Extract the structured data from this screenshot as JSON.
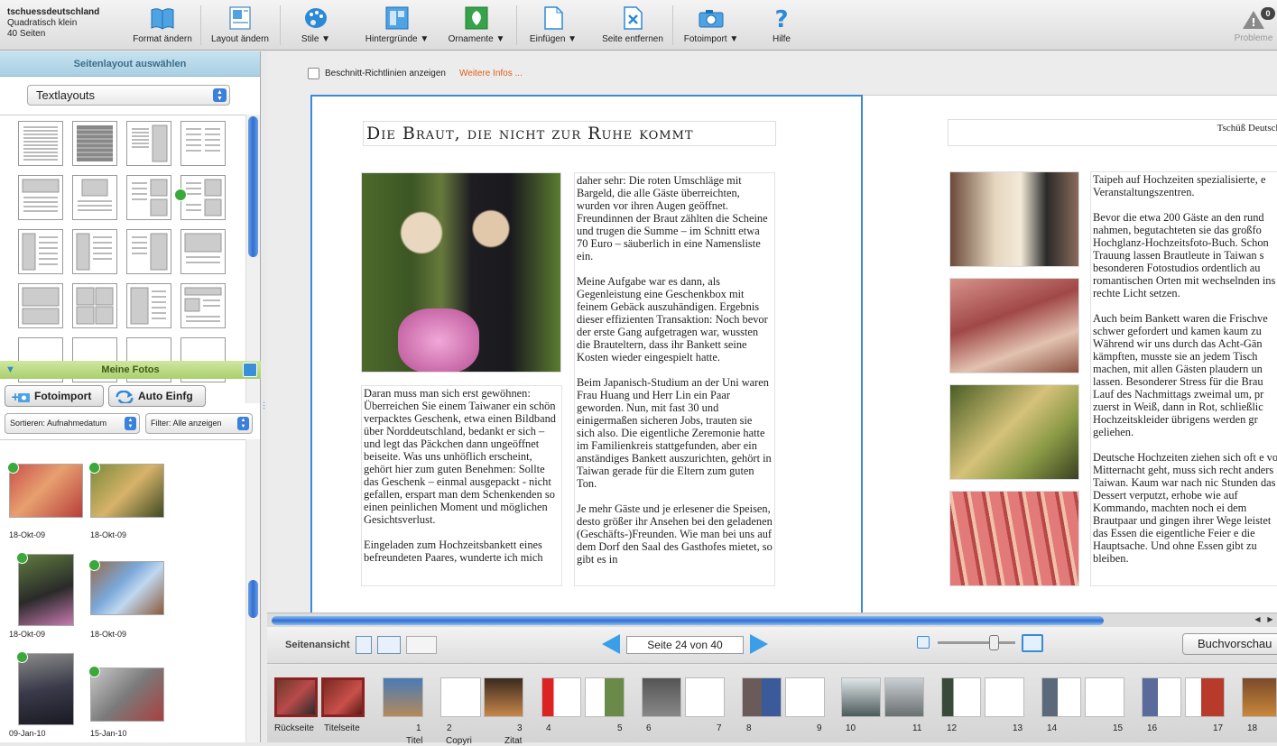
{
  "project": {
    "name": "tschuessdeutschland",
    "format": "Quadratisch klein",
    "pages": "40 Seiten"
  },
  "toolbar": {
    "items": [
      {
        "label": "Format ändern",
        "icon": "book-icon"
      },
      {
        "label": "Layout ändern",
        "icon": "layout-icon"
      },
      {
        "label": "Stile ▼",
        "icon": "palette-icon"
      },
      {
        "label": "Hintergründe ▼",
        "icon": "background-icon"
      },
      {
        "label": "Ornamente ▼",
        "icon": "ornament-icon"
      },
      {
        "label": "Einfügen ▼",
        "icon": "insert-page-icon"
      },
      {
        "label": "Seite entfernen",
        "icon": "remove-page-icon"
      },
      {
        "label": "Fotoimport ▼",
        "icon": "camera-icon"
      },
      {
        "label": "Hilfe",
        "icon": "help-icon"
      }
    ],
    "problems_label": "Probleme",
    "problems_count": "0"
  },
  "layout_panel": {
    "header": "Seitenlayout auswählen",
    "select_value": "Textlayouts"
  },
  "photos_panel": {
    "header": "Meine Fotos",
    "import_btn": "Fotoimport",
    "auto_btn": "Auto Einfg",
    "sort": "Sortieren:  Aufnahmedatum",
    "filter": "Filter: Alle anzeigen",
    "photos": [
      {
        "date": "18-Okt-09"
      },
      {
        "date": "18-Okt-09"
      },
      {
        "date": "18-Okt-09"
      },
      {
        "date": "18-Okt-09"
      },
      {
        "date": "09-Jan-10"
      },
      {
        "date": "15-Jan-10"
      }
    ]
  },
  "editor": {
    "guides_label": "Beschnitt-Richtlinien anzeigen",
    "more_info": "Weitere Infos ...",
    "title": "Die Braut, die nicht zur Ruhe kommt",
    "col1": "Daran muss man sich erst gewöhnen: Überreichen Sie einem Taiwaner ein schön verpacktes Geschenk, etwa einen Bildband über Norddeutschland, bedankt er sich – und legt das Päckchen dann ungeöffnet beiseite. Was uns unhöflich erscheint, gehört hier zum guten Benehmen: Sollte das Geschenk – einmal ausgepackt - nicht gefallen, erspart man dem Schenkenden so einen peinlichen Moment und möglichen Gesichtsverlust.\n\nEingeladen zum Hochzeitsbankett eines befreundeten Paares, wunderte ich mich",
    "col2": "daher sehr: Die roten Umschläge mit Bargeld, die alle Gäste überreichten, wurden vor ihren Augen geöffnet. Freundinnen der Braut zählten die Scheine und trugen die Summe – im Schnitt etwa 70 Euro – säuberlich in eine Namensliste ein.\n\nMeine Aufgabe war es dann, als Gegenleistung eine Geschenkbox mit feinem Gebäck auszuhändigen. Ergebnis dieser effizienten Transaktion: Noch bevor der erste Gang aufgetragen war, wussten die Brauteltern, dass ihr Bankett seine Kosten wieder eingespielt hatte.\n\nBeim Japanisch-Studium an der Uni waren Frau Huang und Herr Lin ein Paar geworden. Nun, mit fast 30 und einigermaßen sicheren Jobs, trauten sie sich also. Die eigentliche Zeremonie hatte im Familienkreis stattgefunden, aber ein anständiges Bankett auszurichten, gehört in Taiwan gerade für die Eltern zum guten Ton.\n\nJe mehr Gäste und je erlesener die Speisen, desto größer ihr Ansehen bei den geladenen (Geschäfts-)Freunden. Wie man bei uns auf dem Dorf den Saal des Gasthofes mietet, so gibt es in",
    "right_header": "Tschüß Deutschla",
    "col3": "Taipeh auf Hochzeiten spezialisierte, e Veranstaltungszentren.\n\nBevor die etwa 200 Gäste an den rund nahmen, begutachteten sie das großfo Hochglanz-Hochzeitsfoto-Buch. Schon Trauung lassen Brautleute in Taiwan s besonderen Fotostudios ordentlich au romantischen Orten mit wechselnden ins rechte Licht setzen.\n\nAuch beim Bankett waren die Frischve schwer gefordert und kamen kaum zu Während wir uns durch das Acht-Gän kämpften, musste sie an jedem Tisch machen, mit allen Gästen plaudern un lassen. Besonderer Stress für die Brau Lauf des Nachmittags zweimal um, pr zuerst in Weiß, dann in Rot, schließlic Hochzeitskleider übrigens werden gr geliehen.\n\nDeutsche Hochzeiten ziehen sich oft e vor Mitternacht geht, muss sich recht anders in Taiwan. Kaum war nach nic Stunden das Dessert verputzt, erhobe wie auf Kommando, machten noch ei dem Brautpaar und gingen ihrer Wege leistet das Essen die eigentliche Feier e die Hauptsache. Und ohne Essen gibt zu bleiben."
  },
  "nav": {
    "view_label": "Seitenansicht",
    "page_indicator": "Seite 24 von 40",
    "preview": "Buchvorschau"
  },
  "strip": {
    "labels": [
      "Rückseite",
      "Titelseite",
      "1",
      "2",
      "3",
      "4",
      "5",
      "6",
      "7",
      "8",
      "9",
      "10",
      "11",
      "12",
      "13",
      "14",
      "15",
      "16",
      "17",
      "18"
    ],
    "sublabels": [
      "Titel",
      "Copyri",
      "Zitat"
    ]
  }
}
